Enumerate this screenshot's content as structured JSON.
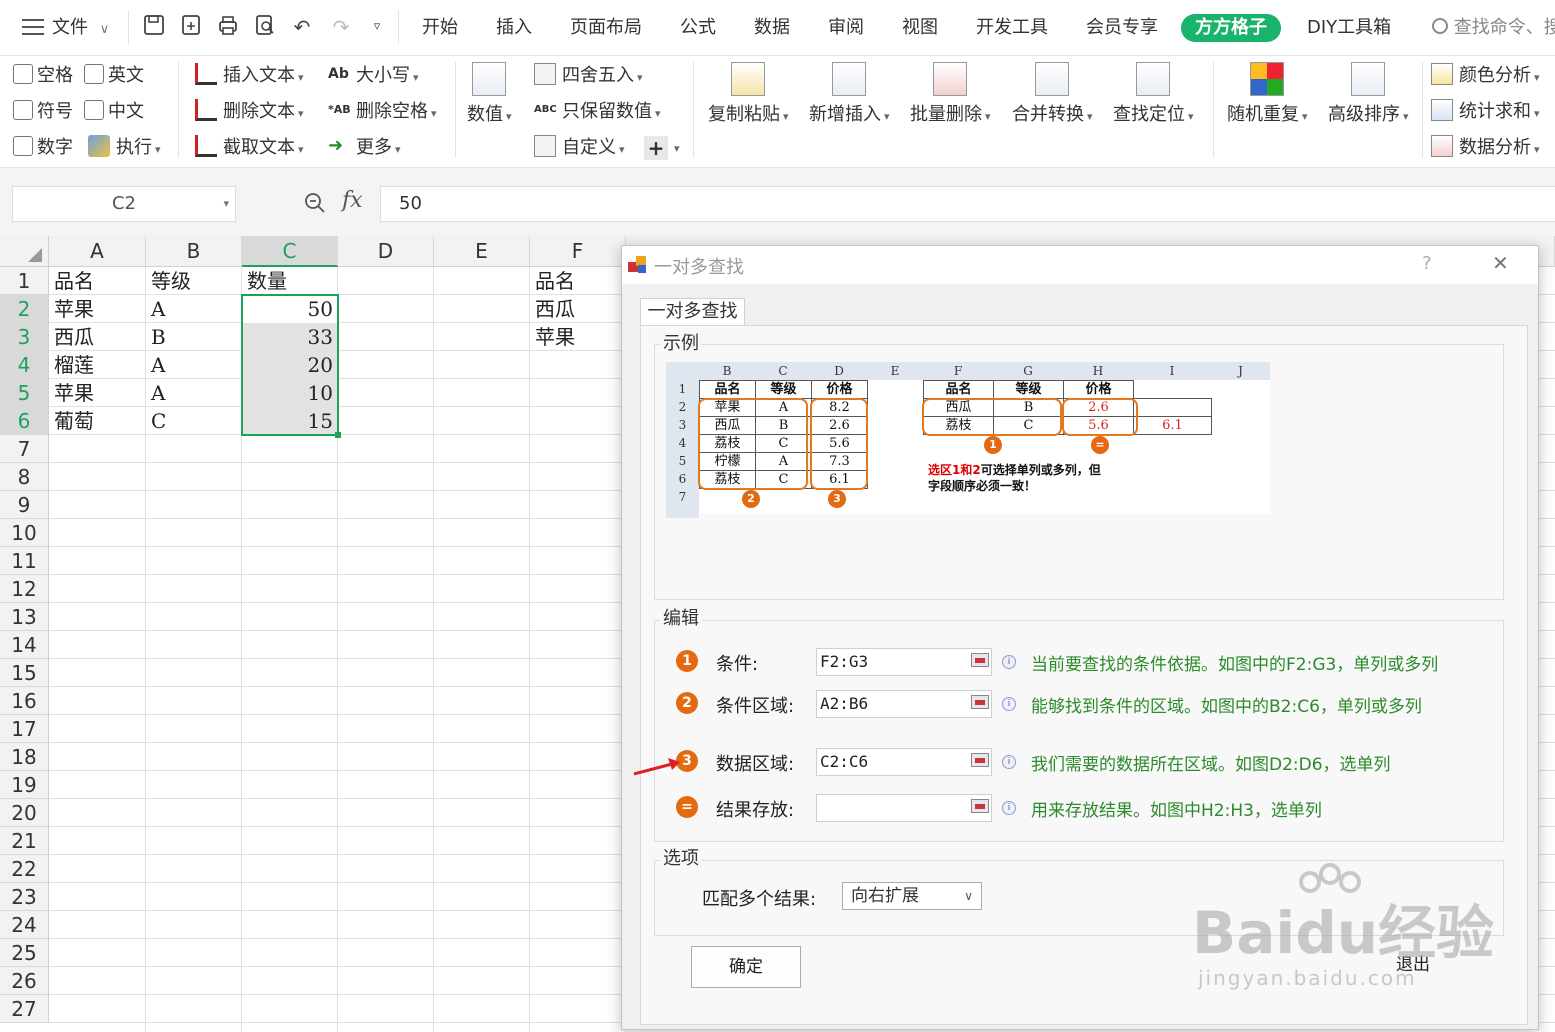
{
  "menubar": {
    "file_label": "文件",
    "tabs": [
      {
        "label": "开始"
      },
      {
        "label": "插入"
      },
      {
        "label": "页面布局"
      },
      {
        "label": "公式"
      },
      {
        "label": "数据"
      },
      {
        "label": "审阅"
      },
      {
        "label": "视图"
      },
      {
        "label": "开发工具"
      },
      {
        "label": "会员专享"
      },
      {
        "label": "方方格子"
      },
      {
        "label": "DIY工具箱"
      }
    ],
    "search_placeholder": "查找命令、搜"
  },
  "ribbon": {
    "checks": [
      "空格",
      "英文",
      "符号",
      "中文",
      "数字"
    ],
    "exec_label": "执行",
    "text_btns": [
      "插入文本",
      "删除文本",
      "截取文本",
      "大小写",
      "删除空格",
      "更多"
    ],
    "value_label": "数值",
    "num_btns": [
      "四舍五入",
      "只保留数值",
      "自定义"
    ],
    "big_btns": [
      "复制粘贴",
      "新增插入",
      "批量删除",
      "合并转换",
      "查找定位",
      "随机重复",
      "高级排序"
    ],
    "right_btns": [
      "颜色分析",
      "统计求和",
      "数据分析"
    ]
  },
  "formula_bar": {
    "cell_ref": "C2",
    "fx_label": "fx",
    "value": "50"
  },
  "sheet": {
    "columns": [
      "A",
      "B",
      "C",
      "D",
      "E",
      "F"
    ],
    "row_numbers": [
      "1",
      "2",
      "3",
      "4",
      "5",
      "6",
      "7",
      "8",
      "9",
      "10",
      "11",
      "12",
      "13",
      "14",
      "15",
      "16",
      "17",
      "18",
      "19",
      "20",
      "21",
      "22",
      "23",
      "24",
      "25",
      "26",
      "27"
    ],
    "rows": [
      {
        "a": "品名",
        "b": "等级",
        "c": "数量",
        "f": "品名"
      },
      {
        "a": "苹果",
        "b": "A",
        "c": "50",
        "f": "西瓜"
      },
      {
        "a": "西瓜",
        "b": "B",
        "c": "33",
        "f": "苹果"
      },
      {
        "a": "榴莲",
        "b": "A",
        "c": "20",
        "f": ""
      },
      {
        "a": "苹果",
        "b": "A",
        "c": "10",
        "f": ""
      },
      {
        "a": "葡萄",
        "b": "C",
        "c": "15",
        "f": ""
      }
    ]
  },
  "dialog": {
    "title": "一对多查找",
    "help": "?",
    "close": "✕",
    "tab_label": "一对多查找",
    "example_group": "示例",
    "example": {
      "col_headers": [
        "B",
        "C",
        "D",
        "E",
        "F",
        "G",
        "H",
        "I",
        "J"
      ],
      "row_headers": [
        "1",
        "2",
        "3",
        "4",
        "5",
        "6",
        "7"
      ],
      "left_table": [
        [
          "品名",
          "等级",
          "价格"
        ],
        [
          "苹果",
          "A",
          "8.2"
        ],
        [
          "西瓜",
          "B",
          "2.6"
        ],
        [
          "荔枝",
          "C",
          "5.6"
        ],
        [
          "柠檬",
          "A",
          "7.3"
        ],
        [
          "荔枝",
          "C",
          "6.1"
        ]
      ],
      "right_table": [
        [
          "品名",
          "等级",
          "价格",
          ""
        ],
        [
          "西瓜",
          "B",
          "2.6",
          ""
        ],
        [
          "荔枝",
          "C",
          "5.6",
          "6.1"
        ]
      ],
      "note_red": "选区1和2",
      "note_rest": "可选择单列或多列，但",
      "note_line2": "字段顺序必须一致！",
      "badges": [
        "1",
        "2",
        "3",
        "="
      ]
    },
    "edit_group": "编辑",
    "fields": [
      {
        "badge": "1",
        "label": "条件:",
        "value": "F2:G3",
        "desc": "当前要查找的条件依据。如图中的F2:G3，单列或多列"
      },
      {
        "badge": "2",
        "label": "条件区域:",
        "value": "A2:B6",
        "desc": "能够找到条件的区域。如图中的B2:C6，单列或多列"
      },
      {
        "badge": "3",
        "label": "数据区域:",
        "value": "C2:C6",
        "desc": "我们需要的数据所在区域。如图D2:D6，选单列"
      },
      {
        "badge": "=",
        "label": "结果存放:",
        "value": "",
        "desc": "用来存放结果。如图中H2:H3，选单列"
      }
    ],
    "options_group": "选项",
    "match_label": "匹配多个结果:",
    "match_value": "向右扩展",
    "ok_label": "确定",
    "exit_label": "退出"
  },
  "watermark": {
    "brand": "Baidu经验",
    "url": "jingyan.baidu.com"
  },
  "colors": {
    "accent_green": "#19b36b",
    "badge_orange": "#e46a12",
    "desc_green": "#2c8a2c",
    "selection_green": "#19a35e"
  }
}
